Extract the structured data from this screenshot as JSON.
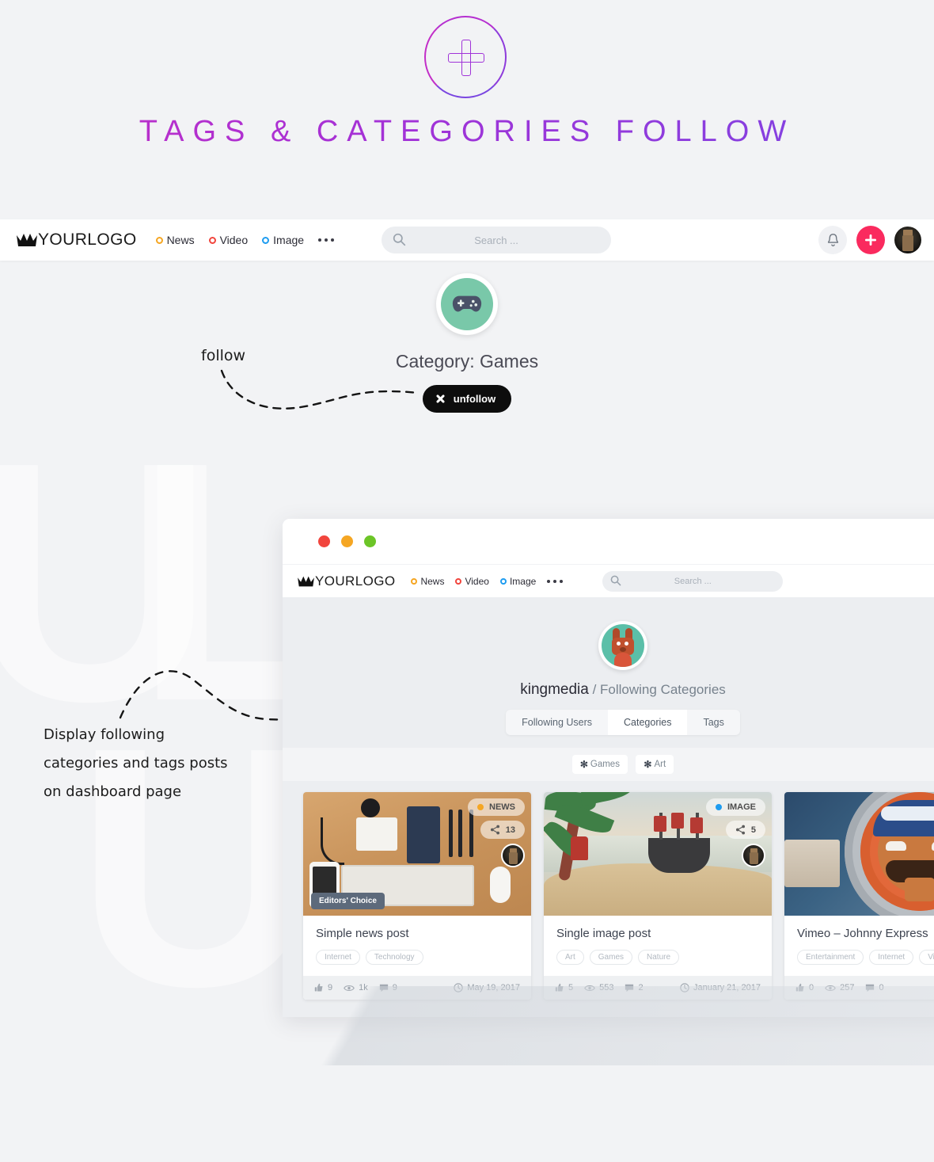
{
  "hero": {
    "title": "TAGS & CATEGORIES FOLLOW",
    "icon": "plus-circle-icon",
    "accent_from": "#c42ec6",
    "accent_to": "#7b45e3"
  },
  "navbar": {
    "logo_text": "YOURLOGO",
    "logo_icon": "crown-icon",
    "links": [
      {
        "label": "News",
        "color": "#f5a623"
      },
      {
        "label": "Video",
        "color": "#f1453d"
      },
      {
        "label": "Image",
        "color": "#1e9cf0"
      }
    ],
    "more_label": "•••",
    "search_placeholder": "Search ...",
    "bell_icon": "bell-icon",
    "add_icon": "plus-icon",
    "add_color": "#fa2a5e",
    "avatar_icon": "user-avatar"
  },
  "category": {
    "avatar_icon": "gamepad-icon",
    "avatar_color": "#79c8a9",
    "title": "Category: Games",
    "unfollow_label": "unfollow",
    "unfollow_icon": "close-icon"
  },
  "annotations": {
    "follow_note": "follow",
    "dashboard_note_line1": "Display following",
    "dashboard_note_line2": "categories and tags posts",
    "dashboard_note_line3": "on dashboard page"
  },
  "browser": {
    "traffic_lights": [
      "#f1453d",
      "#f5a623",
      "#6cc527"
    ],
    "profile": {
      "avatar_icon": "bunny-avatar",
      "username": "kingmedia",
      "separator": "/",
      "section": "Following Categories"
    },
    "tabs": [
      {
        "label": "Following Users",
        "active": false
      },
      {
        "label": "Categories",
        "active": true
      },
      {
        "label": "Tags",
        "active": false
      }
    ],
    "chips": [
      {
        "icon": "asterisk-icon",
        "label": "Games"
      },
      {
        "icon": "asterisk-icon",
        "label": "Art"
      }
    ],
    "cards": [
      {
        "thumb": "desk-flatlay-photo",
        "badge_label": "NEWS",
        "badge_color": "#f5a623",
        "share_icon": "share-icon",
        "share_count": "13",
        "avatar_icon": "author-avatar",
        "ribbon": "Editors' Choice",
        "title": "Simple news post",
        "tags": [
          "Internet",
          "Technology"
        ],
        "likes_icon": "thumbs-up-icon",
        "likes": "9",
        "views_icon": "eye-icon",
        "views": "1k",
        "comments_icon": "comment-icon",
        "comments": "9",
        "date_icon": "clock-icon",
        "date": "May 19, 2017"
      },
      {
        "thumb": "lego-pirate-scene",
        "badge_label": "IMAGE",
        "badge_color": "#1e9cf0",
        "share_icon": "share-icon",
        "share_count": "5",
        "avatar_icon": "author-avatar",
        "ribbon": "",
        "title": "Single image post",
        "tags": [
          "Art",
          "Games",
          "Nature"
        ],
        "likes_icon": "thumbs-up-icon",
        "likes": "5",
        "views_icon": "eye-icon",
        "views": "553",
        "comments_icon": "comment-icon",
        "comments": "2",
        "date_icon": "clock-icon",
        "date": "January 21, 2017"
      },
      {
        "thumb": "johnny-express-still",
        "badge_label": "",
        "badge_color": "#1e9cf0",
        "share_icon": "share-icon",
        "share_count": "",
        "avatar_icon": "author-avatar",
        "ribbon": "",
        "title": "Vimeo – Johnny Express",
        "tags": [
          "Entertainment",
          "Internet",
          "Video"
        ],
        "likes_icon": "thumbs-up-icon",
        "likes": "0",
        "views_icon": "eye-icon",
        "views": "257",
        "comments_icon": "comment-icon",
        "comments": "0",
        "date_icon": "clock-icon",
        "date": ""
      }
    ]
  }
}
